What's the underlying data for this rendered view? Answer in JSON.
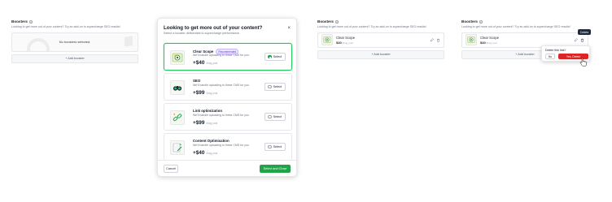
{
  "panel1": {
    "title": "Boosters",
    "subtitle": "Looking to get more out of your content? Try an add-on to supercharge SEO results!",
    "empty_text": "No boosters selected.",
    "add_label": "+ Add booster"
  },
  "modal": {
    "title": "Looking to get more out of your content?",
    "subtitle": "Select a booster deliverable to supercharge performance.",
    "close_glyph": "×",
    "options": [
      {
        "name": "Clear Scope",
        "badge": "Recommended",
        "desc": "We'll handle uploading to these CMS for you",
        "price": "+$40",
        "unit": "/blog post",
        "select": "Select",
        "selected": true
      },
      {
        "name": "SEO",
        "desc": "We'll handle uploading to these CMS for you",
        "price": "+$99",
        "unit": "/blog post",
        "select": "Select",
        "selected": false
      },
      {
        "name": "Link optimization",
        "desc": "We'll handle uploading to these CMS for you",
        "price": "+$99",
        "unit": "/blog post",
        "select": "Select",
        "selected": false
      },
      {
        "name": "Content Optimisation",
        "desc": "We'll handle uploading to these CMS for you",
        "price": "+$40",
        "unit": "/blog post",
        "select": "Select",
        "selected": false
      }
    ],
    "cancel_label": "Cancel",
    "confirm_label": "Select and Close"
  },
  "panel3": {
    "title": "Boosters",
    "subtitle": "Looking to get more out of your content? Try an add-on to supercharge SEO results!",
    "booster": {
      "name": "Clear Scope",
      "price": "$40",
      "unit": "/blog post"
    },
    "add_label": "+ Add booster"
  },
  "panel4": {
    "title": "Boosters",
    "subtitle": "Looking to get more out of your content? Try an add-on to supercharge SEO results!",
    "booster": {
      "name": "Clear Scope",
      "price": "$40",
      "unit": "/blog post"
    },
    "add_label": "+ Add booster",
    "tooltip": "Delete",
    "popover": {
      "title": "Delete this link?",
      "no": "No",
      "yes": "Yes, Delete"
    }
  },
  "colors": {
    "accent_green": "#22a34a",
    "danger": "#dc2626",
    "badge_purple": "#6d28d9"
  }
}
